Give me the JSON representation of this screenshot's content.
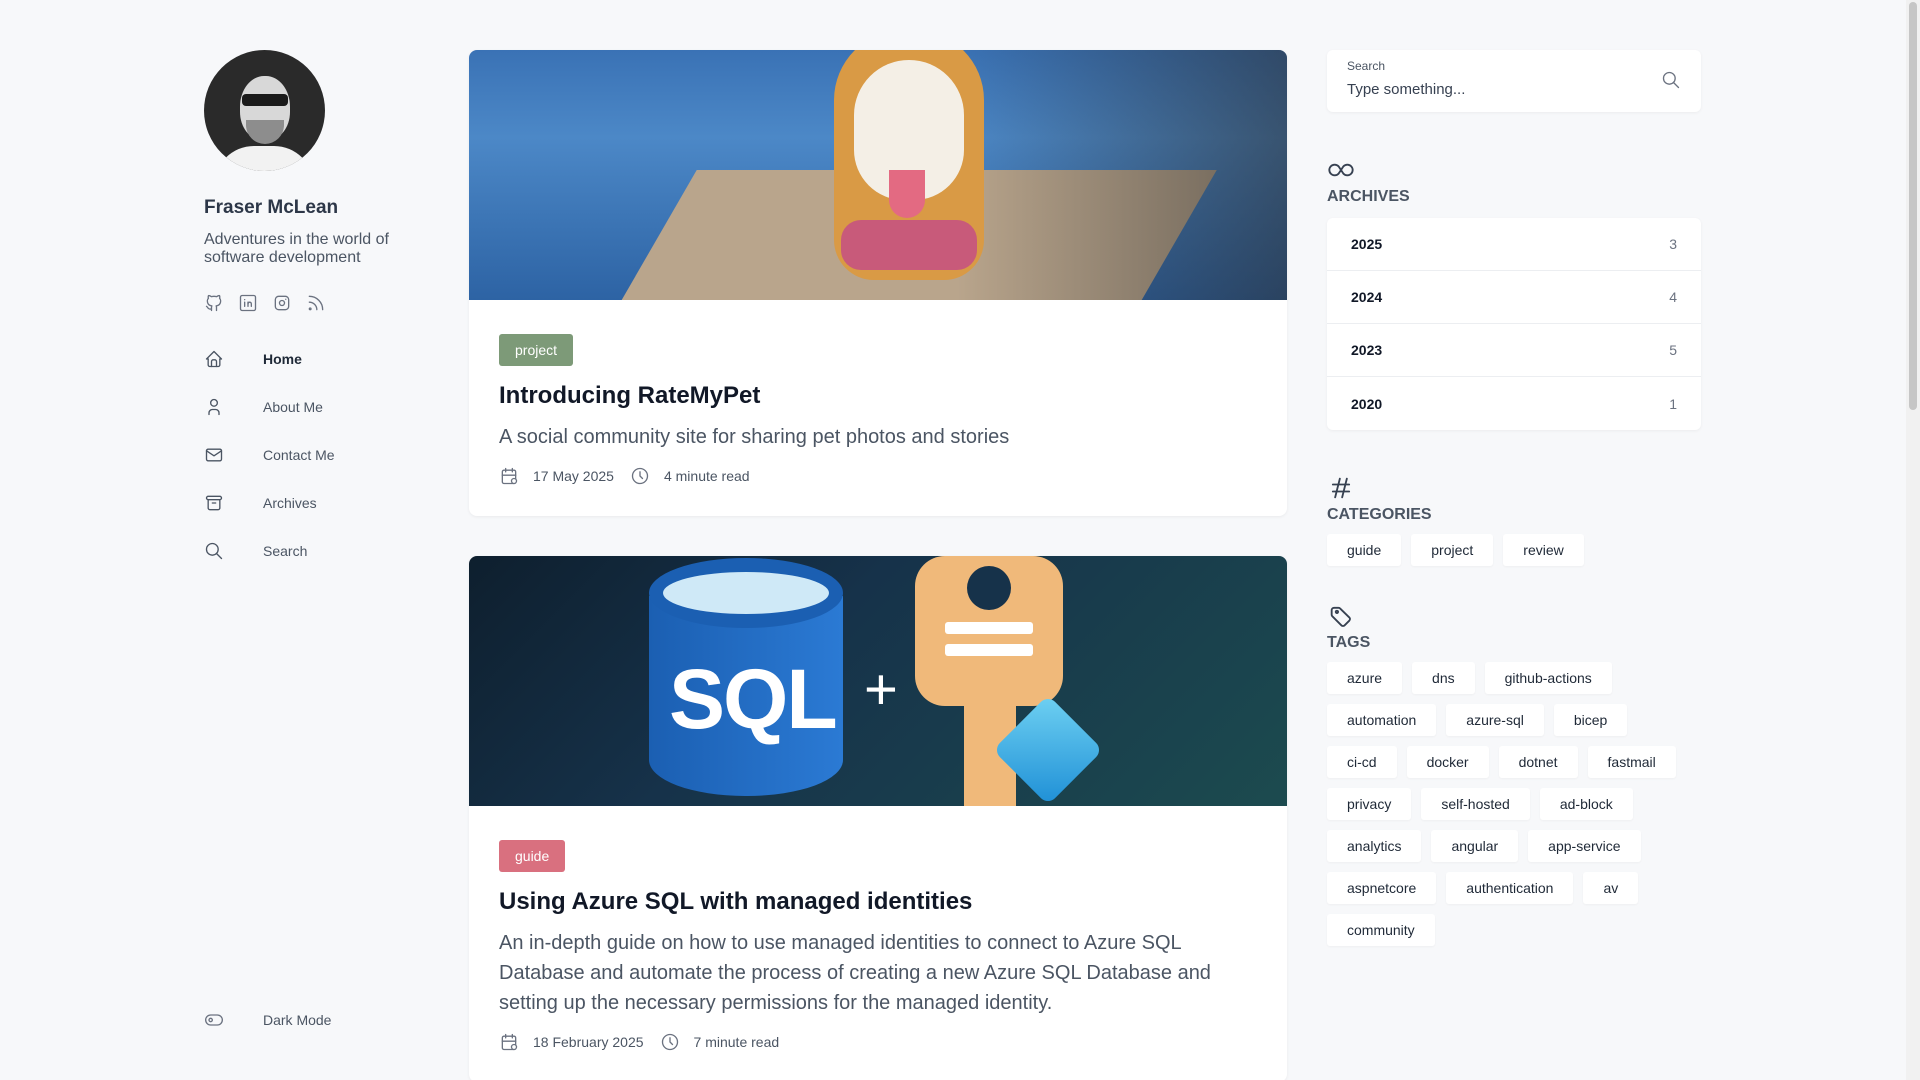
{
  "profile": {
    "name": "Fraser McLean",
    "bio": "Adventures in the world of software development",
    "social_icons": [
      "github-icon",
      "linkedin-icon",
      "instagram-icon",
      "rss-icon"
    ]
  },
  "nav": {
    "items": [
      {
        "label": "Home",
        "icon": "home-icon",
        "active": true
      },
      {
        "label": "About Me",
        "icon": "user-icon"
      },
      {
        "label": "Contact Me",
        "icon": "mail-icon"
      },
      {
        "label": "Archives",
        "icon": "archive-icon"
      },
      {
        "label": "Search",
        "icon": "search-icon"
      }
    ],
    "dark_mode_label": "Dark Mode"
  },
  "posts": [
    {
      "category": "project",
      "category_color": "#7d9a78",
      "title": "Introducing RateMyPet",
      "subtitle": "A social community site for sharing pet photos and stories",
      "date": "17 May 2025",
      "read_time": "4 minute read"
    },
    {
      "category": "guide",
      "category_color": "#d9707f",
      "title": "Using Azure SQL with managed identities",
      "subtitle": "An in-depth guide on how to use managed identities to connect to Azure SQL Database and automate the process of creating a new Azure SQL Database and setting up the necessary permissions for the managed identity.",
      "date": "18 February 2025",
      "read_time": "7 minute read"
    }
  ],
  "search": {
    "label": "Search",
    "placeholder": "Type something..."
  },
  "archives": {
    "title": "ARCHIVES",
    "years": [
      {
        "year": "2025",
        "count": "3"
      },
      {
        "year": "2024",
        "count": "4"
      },
      {
        "year": "2023",
        "count": "5"
      },
      {
        "year": "2020",
        "count": "1"
      }
    ]
  },
  "categories": {
    "title": "CATEGORIES",
    "items": [
      "guide",
      "project",
      "review"
    ]
  },
  "tags": {
    "title": "TAGS",
    "items": [
      "azure",
      "dns",
      "github-actions",
      "automation",
      "azure-sql",
      "bicep",
      "ci-cd",
      "docker",
      "dotnet",
      "fastmail",
      "privacy",
      "self-hosted",
      "ad-block",
      "analytics",
      "angular",
      "app-service",
      "aspnetcore",
      "authentication",
      "av",
      "community"
    ]
  }
}
